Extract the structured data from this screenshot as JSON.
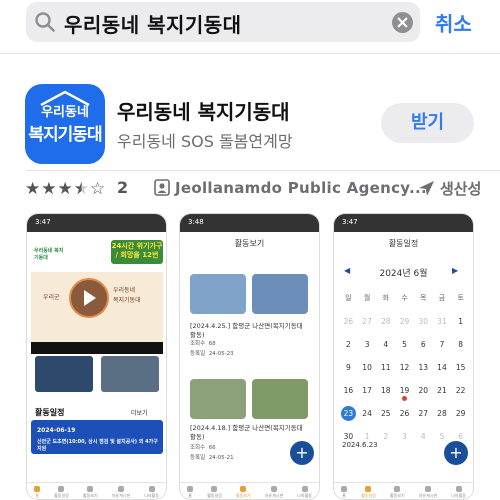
{
  "search": {
    "query": "우리동네 복지기동대",
    "cancel_label": "취소"
  },
  "app": {
    "icon_text_top": "우리동네",
    "icon_text_main": "복지기동대",
    "name": "우리동네 복지기동대",
    "subtitle": "우리동네 SOS 돌봄연계망",
    "get_label": "받기",
    "rating_stars": 3.5,
    "rating_count": "2",
    "developer": "Jeollanamdo Public Agency...",
    "category": "생산성"
  },
  "screenshots": {
    "shot1": {
      "time": "3:47",
      "logo": "우리동네 복지기동대",
      "banner": "24시간 위기가구 / 희망을 12번",
      "video_left": "우리군",
      "video_text": "우리동네\n복지기동대",
      "section_title": "활동일정",
      "more_label": "더보기",
      "card_date": "2024-06-19",
      "card_text": "신안군 도초면(10:00, 상시 점검 및 설치공사) 외 4가구 지원",
      "tabs": [
        "홈",
        "활동일정",
        "활동보기",
        "자유게시판",
        "나의활동"
      ]
    },
    "shot2": {
      "time": "3:48",
      "title": "활동보기",
      "posts": [
        {
          "caption": "[2024.4.25.] 함평군 나산면(복지기동대 활동)",
          "views_label": "조회수",
          "views": "68",
          "date_label": "등록일",
          "date": "24-05-23"
        },
        {
          "caption": "[2024.4.18.] 함평군 나산면(복지기동대 활동)",
          "views_label": "조회수",
          "views": "66",
          "date_label": "등록일",
          "date": "24-05-21"
        }
      ],
      "fab": "+",
      "tabs": [
        "홈",
        "활동일정",
        "활동보기",
        "자유게시판",
        "나의활동"
      ]
    },
    "shot3": {
      "time": "3:47",
      "title": "활동일정",
      "month": "2024년 6월",
      "weekdays": [
        "일",
        "월",
        "화",
        "수",
        "목",
        "금",
        "토"
      ],
      "weeks": [
        [
          "26",
          "27",
          "28",
          "29",
          "30",
          "31",
          "1"
        ],
        [
          "2",
          "3",
          "4",
          "5",
          "6",
          "7",
          "8"
        ],
        [
          "9",
          "10",
          "11",
          "12",
          "13",
          "14",
          "15"
        ],
        [
          "16",
          "17",
          "18",
          "19",
          "20",
          "21",
          "22"
        ],
        [
          "23",
          "24",
          "25",
          "26",
          "27",
          "28",
          "29"
        ],
        [
          "30",
          "1",
          "2",
          "3",
          "4",
          "5",
          "6"
        ]
      ],
      "selected_date": "2024.6.23",
      "fab": "+",
      "tabs": [
        "홈",
        "활동일정",
        "활동보기",
        "자유게시판",
        "나의활동"
      ]
    }
  },
  "colors": {
    "accent": "#2f7bf6",
    "app_icon": "#1f6dea",
    "banner_green": "#3a8b3a",
    "card_blue": "#1c4fb8",
    "fab": "#1a4e9a"
  }
}
